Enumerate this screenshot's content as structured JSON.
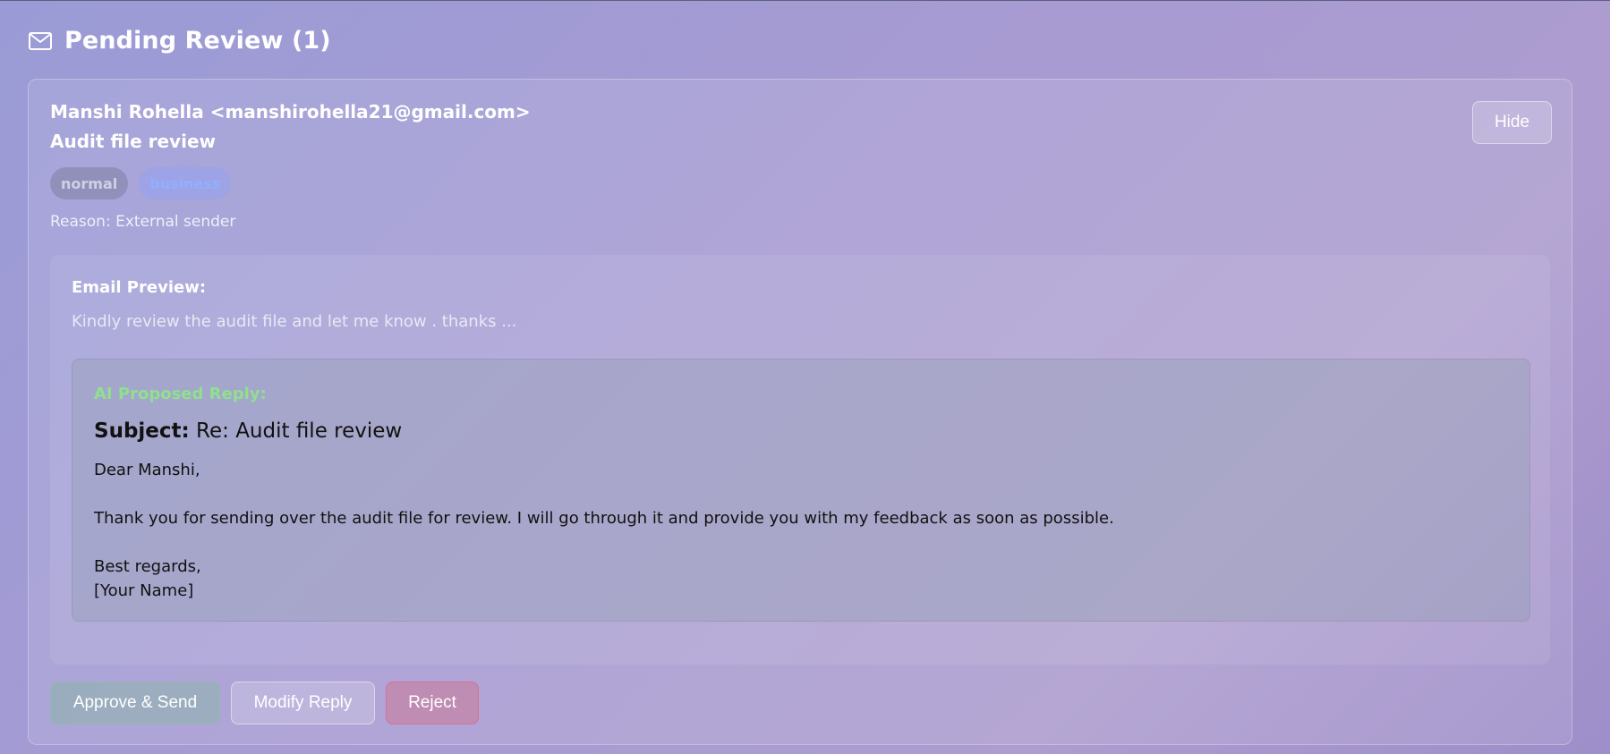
{
  "header": {
    "icon": "mail-icon",
    "title": "Pending Review (1)"
  },
  "email": {
    "sender": "Manshi Rohella <manshirohella21@gmail.com>",
    "subject": "Audit file review",
    "tags": [
      "normal",
      "business"
    ],
    "reason": "Reason: External sender",
    "hide_label": "Hide",
    "preview_label": "Email Preview:",
    "preview_text": "Kindly review the audit file and let me know . thanks ..."
  },
  "ai_reply": {
    "label": "AI Proposed Reply:",
    "subject_key": "Subject:",
    "subject_value": "Re: Audit file review",
    "greeting": "Dear Manshi,",
    "body": "Thank you for sending over the audit file for review. I will go through it and provide you with my feedback as soon as possible.",
    "closing": "Best regards,",
    "signature": "[Your Name]"
  },
  "actions": {
    "approve_label": "Approve & Send",
    "modify_label": "Modify Reply",
    "reject_label": "Reject"
  },
  "colors": {
    "ai_label": "#8fe08f",
    "business_tag": "#8fb0ff",
    "reject_border": "#e16482"
  }
}
